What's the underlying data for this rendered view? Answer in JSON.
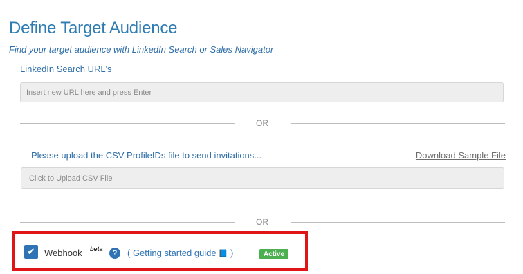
{
  "header": {
    "title": "Define Target Audience",
    "subtitle": "Find your target audience with LinkedIn Search or Sales Navigator"
  },
  "search_url": {
    "label": "LinkedIn Search URL's",
    "placeholder": "Insert new URL here and press Enter",
    "value": ""
  },
  "dividers": {
    "first": "OR",
    "second": "OR"
  },
  "csv_upload": {
    "label": "Please upload the CSV ProfileIDs file to send invitations...",
    "sample_link": "Download Sample File",
    "upload_text": "Click to Upload CSV File"
  },
  "webhook": {
    "checked": true,
    "check_glyph": "✔",
    "label": "Webhook",
    "beta": "beta",
    "help_glyph": "?",
    "guide_open": "( Getting started guide",
    "guide_icon": "📘",
    "guide_close": " )",
    "status": "Active"
  },
  "colors": {
    "title": "#2f7cb3",
    "link": "#2f73b5",
    "highlight_border": "#e01515",
    "active_badge": "#4caf50"
  }
}
